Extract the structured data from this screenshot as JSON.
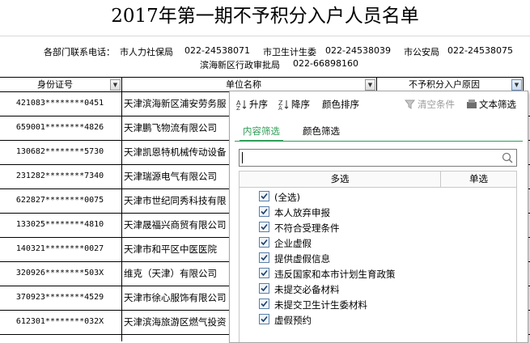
{
  "title": "2017年第一期不予积分入户人员名单",
  "contacts": {
    "lead": "各部门联系电话：",
    "items": [
      {
        "dept": "市人力社保局",
        "phone": "022-24538071"
      },
      {
        "dept": "市卫生计生委",
        "phone": "022-24538039"
      },
      {
        "dept": "市公安局",
        "phone": "022-24538075"
      },
      {
        "dept": "滨海新区行政审批局",
        "phone": "022-66898160"
      }
    ]
  },
  "table": {
    "headers": [
      "身份证号",
      "单位名称",
      "不予积分入户原因"
    ],
    "rows": [
      {
        "id": "421083********0451",
        "unit": "天津滨海新区浦安劳务服"
      },
      {
        "id": "659001********4826",
        "unit": "天津鹏飞物流有限公司"
      },
      {
        "id": "130682********5730",
        "unit": "天津凯恩特机械传动设备"
      },
      {
        "id": "231282********7340",
        "unit": "天津瑞源电气有限公司"
      },
      {
        "id": "622827********0075",
        "unit": "天津市世纪同秀科技有限"
      },
      {
        "id": "133025********4810",
        "unit": "天津晟福兴商贸有限公司"
      },
      {
        "id": "140321********0027",
        "unit": "天津市和平区中医医院"
      },
      {
        "id": "320926********503X",
        "unit": "维克（天津）有限公司"
      },
      {
        "id": "370923********4529",
        "unit": "天津市徐心服饰有限公司"
      },
      {
        "id": "612301********032X",
        "unit": "天津滨海旅游区燃气投资"
      }
    ]
  },
  "filter_panel": {
    "toolbar": {
      "asc": "升序",
      "desc": "降序",
      "color_sort": "颜色排序",
      "clear": "清空条件",
      "text_filter": "文本筛选"
    },
    "tabs": [
      "内容筛选",
      "颜色筛选"
    ],
    "search_value": "",
    "list_headers": {
      "multi": "多选",
      "single": "单选"
    },
    "options": [
      {
        "label": "(全选)",
        "checked": true
      },
      {
        "label": "本人放弃申报",
        "checked": true
      },
      {
        "label": "不符合受理条件",
        "checked": true
      },
      {
        "label": "企业虚假",
        "checked": true
      },
      {
        "label": "提供虚假信息",
        "checked": true
      },
      {
        "label": "违反国家和本市计划生育政策",
        "checked": true
      },
      {
        "label": "未提交必备材料",
        "checked": true
      },
      {
        "label": "未提交卫生计生委材料",
        "checked": true
      },
      {
        "label": "虚假预约",
        "checked": true
      }
    ],
    "colors": {
      "accent": "#2e9e57",
      "checkbox_border": "#5a7fa6"
    }
  }
}
